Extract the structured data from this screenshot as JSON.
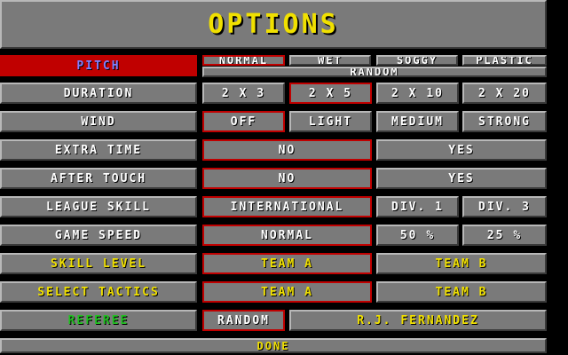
{
  "title": "OPTIONS",
  "pitch": {
    "label": "PITCH",
    "options": [
      "NORMAL",
      "WET",
      "SOGGY",
      "PLASTIC"
    ],
    "extra": "RANDOM"
  },
  "duration": {
    "label": "DURATION",
    "options": [
      "2 X 3",
      "2 X 5",
      "2 X 10",
      "2 X 20"
    ]
  },
  "wind": {
    "label": "WIND",
    "options": [
      "OFF",
      "LIGHT",
      "MEDIUM",
      "STRONG"
    ]
  },
  "extra_time": {
    "label": "EXTRA TIME",
    "options": [
      "NO",
      "YES"
    ]
  },
  "after_touch": {
    "label": "AFTER TOUCH",
    "options": [
      "NO",
      "YES"
    ]
  },
  "league_skill": {
    "label": "LEAGUE SKILL",
    "options": [
      "INTERNATIONAL",
      "DIV. 1",
      "DIV. 3"
    ]
  },
  "game_speed": {
    "label": "GAME SPEED",
    "options": [
      "NORMAL",
      "50 %",
      "25 %"
    ]
  },
  "skill_level": {
    "label": "SKILL LEVEL",
    "options": [
      "TEAM A",
      "TEAM B"
    ]
  },
  "select_tactics": {
    "label": "SELECT TACTICS",
    "options": [
      "TEAM A",
      "TEAM B"
    ]
  },
  "referee": {
    "label": "REFEREE",
    "options": [
      "RANDOM",
      "R.J. FERNANDEZ"
    ]
  },
  "done": "DONE",
  "colors": {
    "panel": "#7a7a7a",
    "selected_border": "#c00000",
    "yellow": "#f0e000",
    "green": "#20c020",
    "blue_label": "#7070ff"
  }
}
